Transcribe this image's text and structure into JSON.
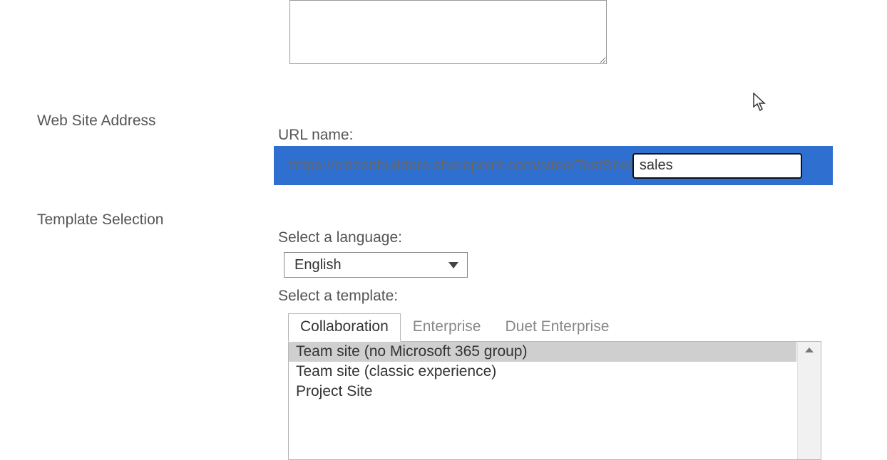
{
  "description": {
    "value": ""
  },
  "webSiteAddress": {
    "section_label": "Web Site Address",
    "url_name_label": "URL name:",
    "url_prefix": "https://citizenbuilders.sharepoint.com/sites/TestSite/",
    "url_value": "sales"
  },
  "templateSelection": {
    "section_label": "Template Selection",
    "language_label": "Select a language:",
    "language_value": "English",
    "template_label": "Select a template:",
    "tabs": [
      {
        "label": "Collaboration",
        "active": true
      },
      {
        "label": "Enterprise",
        "active": false
      },
      {
        "label": "Duet Enterprise",
        "active": false
      }
    ],
    "templates": [
      {
        "label": "Team site (no Microsoft 365 group)",
        "selected": true
      },
      {
        "label": "Team site (classic experience)",
        "selected": false
      },
      {
        "label": "Project Site",
        "selected": false
      }
    ]
  }
}
